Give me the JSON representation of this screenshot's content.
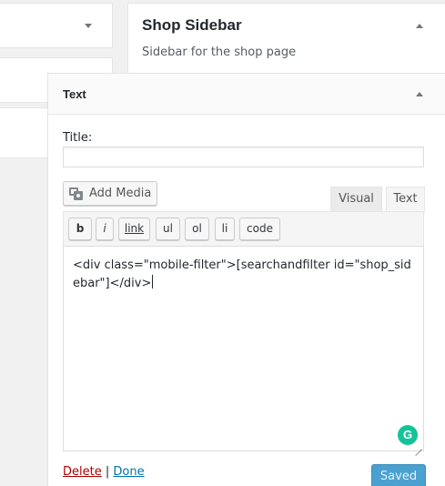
{
  "left_column": {
    "boxes": [
      "",
      "",
      ""
    ]
  },
  "sidebar": {
    "title": "Shop Sidebar",
    "description": "Sidebar for the shop page"
  },
  "widget": {
    "title": "Text",
    "title_field_label": "Title:",
    "title_field_value": "",
    "add_media_label": "Add Media",
    "tabs": {
      "visual": "Visual",
      "text": "Text",
      "active": "Text"
    },
    "quicktags": [
      "b",
      "i",
      "link",
      "ul",
      "ol",
      "li",
      "code"
    ],
    "content": "<div class=\"mobile-filter\">[searchandfilter id=\"shop_sidebar\"]</div>",
    "grammarly_badge": "G",
    "delete_label": "Delete",
    "separator": "|",
    "done_label": "Done",
    "save_label": "Saved"
  },
  "colors": {
    "delete": "#a00000",
    "done": "#0073aa",
    "save_button": "#4aa1cf",
    "grammarly": "#15c39a"
  }
}
